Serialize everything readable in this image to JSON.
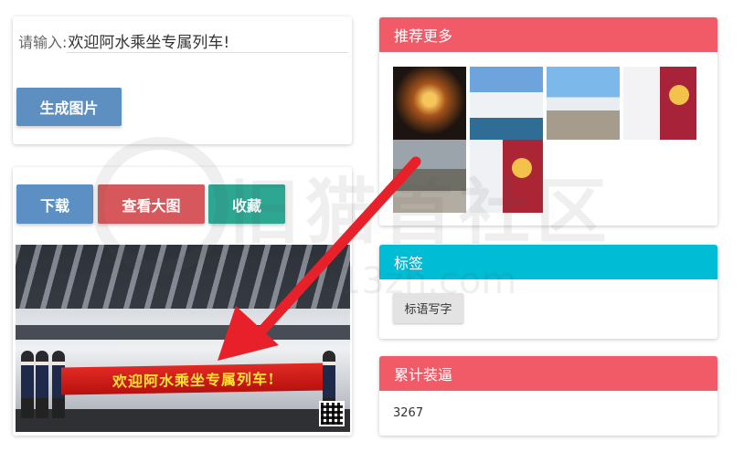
{
  "generator": {
    "input_label": "请输入:",
    "input_value": "欢迎阿水乘坐专属列车!",
    "generate_label": "生成图片"
  },
  "actions": {
    "download_label": "下载",
    "view_large_label": "查看大图",
    "favorite_label": "收藏"
  },
  "result_image": {
    "banner_text": "欢迎阿水乘坐专属列车!"
  },
  "recommend": {
    "title": "推荐更多",
    "thumbnails": [
      {
        "name": "hotel-thumb"
      },
      {
        "name": "yacht-thumb"
      },
      {
        "name": "airplane-thumb"
      },
      {
        "name": "certificate-thumb"
      },
      {
        "name": "building-thumb"
      },
      {
        "name": "license-thumb"
      }
    ]
  },
  "tags": {
    "title": "标签",
    "items": [
      "标语写字"
    ]
  },
  "counter": {
    "title": "累计装逼",
    "value": "3267"
  },
  "watermark": {
    "text": "旧猫首社区",
    "url": "13zh.com"
  },
  "colors": {
    "blue_button": "#5e8fc1",
    "red_button": "#d6585c",
    "teal_button": "#2da692",
    "panel_red": "#f15b68",
    "panel_cyan": "#00bcd4",
    "arrow_red": "#e8202a"
  }
}
